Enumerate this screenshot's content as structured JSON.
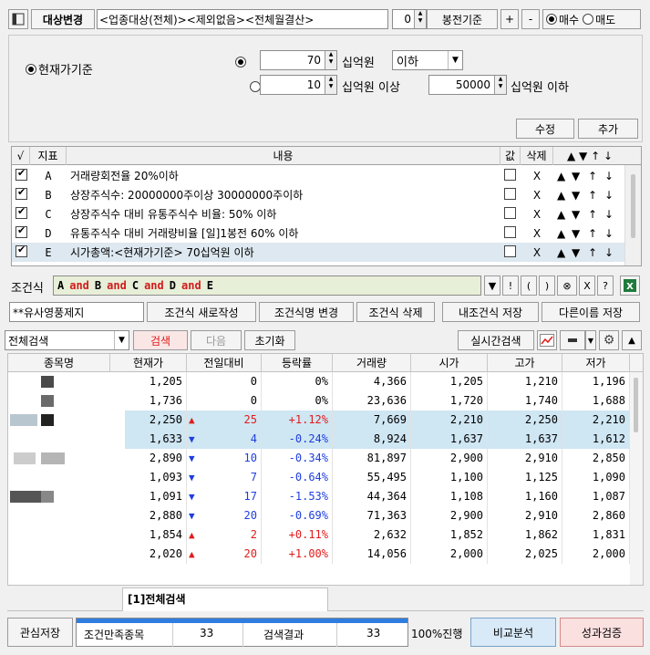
{
  "toolbar": {
    "target_change_label": "대상변경",
    "filter_text": "<업종대상(전체)><제외없음><전체월결산>",
    "bong_value": "0",
    "bong_label": "봉전기준",
    "plus_label": "+",
    "minus_label": "-",
    "buy_label": "매수",
    "sell_label": "매도"
  },
  "settings": {
    "current_price_label": "현재가기준",
    "row1_value": "70",
    "row1_unit": "십억원",
    "row1_select": "이하",
    "row2_value": "10",
    "row2_unit": "십억원 이상",
    "row2_value2": "50000",
    "row2_unit2": "십억원 이하",
    "modify_label": "수정",
    "add_label": "추가"
  },
  "condition_table": {
    "headers": {
      "check": "√",
      "index": "지표",
      "content": "내용",
      "value": "값",
      "delete": "삭제"
    },
    "arrows": [
      "▲",
      "▼",
      "↑",
      "↓"
    ],
    "rows": [
      {
        "id": "A",
        "content": "거래량회전율 20%이하",
        "del": "X"
      },
      {
        "id": "B",
        "content": "상장주식수: 20000000주이상 30000000주이하",
        "del": "X"
      },
      {
        "id": "C",
        "content": "상장주식수 대비 유통주식수 비율: 50% 이하",
        "del": "X"
      },
      {
        "id": "D",
        "content": "유통주식수 대비 거래량비율 [일]1봉전 60% 이하",
        "del": "X"
      },
      {
        "id": "E",
        "content": "시가총액:<현재가기준> 70십억원 이하",
        "del": "X"
      }
    ]
  },
  "formula": {
    "label": "조건식",
    "tokens": [
      "A",
      "and",
      "B",
      "and",
      "C",
      "and",
      "D",
      "and",
      "E"
    ],
    "buttons": [
      "▼",
      "!",
      "(",
      ")",
      "⊗",
      "X",
      "?"
    ]
  },
  "actions": {
    "name_field": "**유사영풍제지",
    "new_label": "조건식 새로작성",
    "rename_label": "조건식명 변경",
    "delete_label": "조건식 삭제",
    "save_label": "내조건식 저장",
    "save_as_label": "다른이름 저장"
  },
  "search_bar": {
    "scope": "전체검색",
    "search_label": "검색",
    "next_label": "다음",
    "reset_label": "초기화",
    "realtime_label": "실시간검색"
  },
  "results": {
    "headers": [
      "종목명",
      "현재가",
      "전일대비",
      "등락률",
      "거래량",
      "시가",
      "고가",
      "저가"
    ],
    "rows": [
      {
        "price": "1,205",
        "dir": "",
        "change": "0",
        "rate": "0%",
        "volume": "4,366",
        "open": "1,205",
        "high": "1,210",
        "low": "1,196",
        "sel": false
      },
      {
        "price": "1,736",
        "dir": "",
        "change": "0",
        "rate": "0%",
        "volume": "23,636",
        "open": "1,720",
        "high": "1,740",
        "low": "1,688",
        "sel": false
      },
      {
        "price": "2,250",
        "dir": "up",
        "change": "25",
        "rate": "+1.12%",
        "volume": "7,669",
        "open": "2,210",
        "high": "2,250",
        "low": "2,210",
        "sel": false
      },
      {
        "price": "1,633",
        "dir": "down",
        "change": "4",
        "rate": "-0.24%",
        "volume": "8,924",
        "open": "1,637",
        "high": "1,637",
        "low": "1,612",
        "sel": true
      },
      {
        "price": "2,890",
        "dir": "down",
        "change": "10",
        "rate": "-0.34%",
        "volume": "81,897",
        "open": "2,900",
        "high": "2,910",
        "low": "2,850",
        "sel": false
      },
      {
        "price": "1,093",
        "dir": "down",
        "change": "7",
        "rate": "-0.64%",
        "volume": "55,495",
        "open": "1,100",
        "high": "1,125",
        "low": "1,090",
        "sel": false
      },
      {
        "price": "1,091",
        "dir": "down",
        "change": "17",
        "rate": "-1.53%",
        "volume": "44,364",
        "open": "1,108",
        "high": "1,160",
        "low": "1,087",
        "sel": false
      },
      {
        "price": "2,880",
        "dir": "down",
        "change": "20",
        "rate": "-0.69%",
        "volume": "71,363",
        "open": "2,900",
        "high": "2,910",
        "low": "2,860",
        "sel": false
      },
      {
        "price": "1,854",
        "dir": "up",
        "change": "2",
        "rate": "+0.11%",
        "volume": "2,632",
        "open": "1,852",
        "high": "1,862",
        "low": "1,831",
        "sel": false
      },
      {
        "price": "2,020",
        "dir": "up",
        "change": "20",
        "rate": "+1.00%",
        "volume": "14,056",
        "open": "2,000",
        "high": "2,025",
        "low": "2,000",
        "sel": false
      }
    ],
    "tab_label": "[1]전체검색"
  },
  "status": {
    "watch_save_label": "관심저장",
    "match_label": "조건만족종목",
    "match_count": "33",
    "result_label": "검색결과",
    "result_count": "33",
    "progress_label": "100%진행",
    "progress_fraction": 1.0,
    "compare_label": "비교분석",
    "perf_label": "성과검증"
  },
  "colors": {
    "up": "#e21a1a",
    "down": "#1e3ee0",
    "selected_row": "#cfe6f3",
    "formula_bg": "#e8efd8",
    "formula_keyword": "#d21c1c",
    "progress": "#2f7de0"
  }
}
